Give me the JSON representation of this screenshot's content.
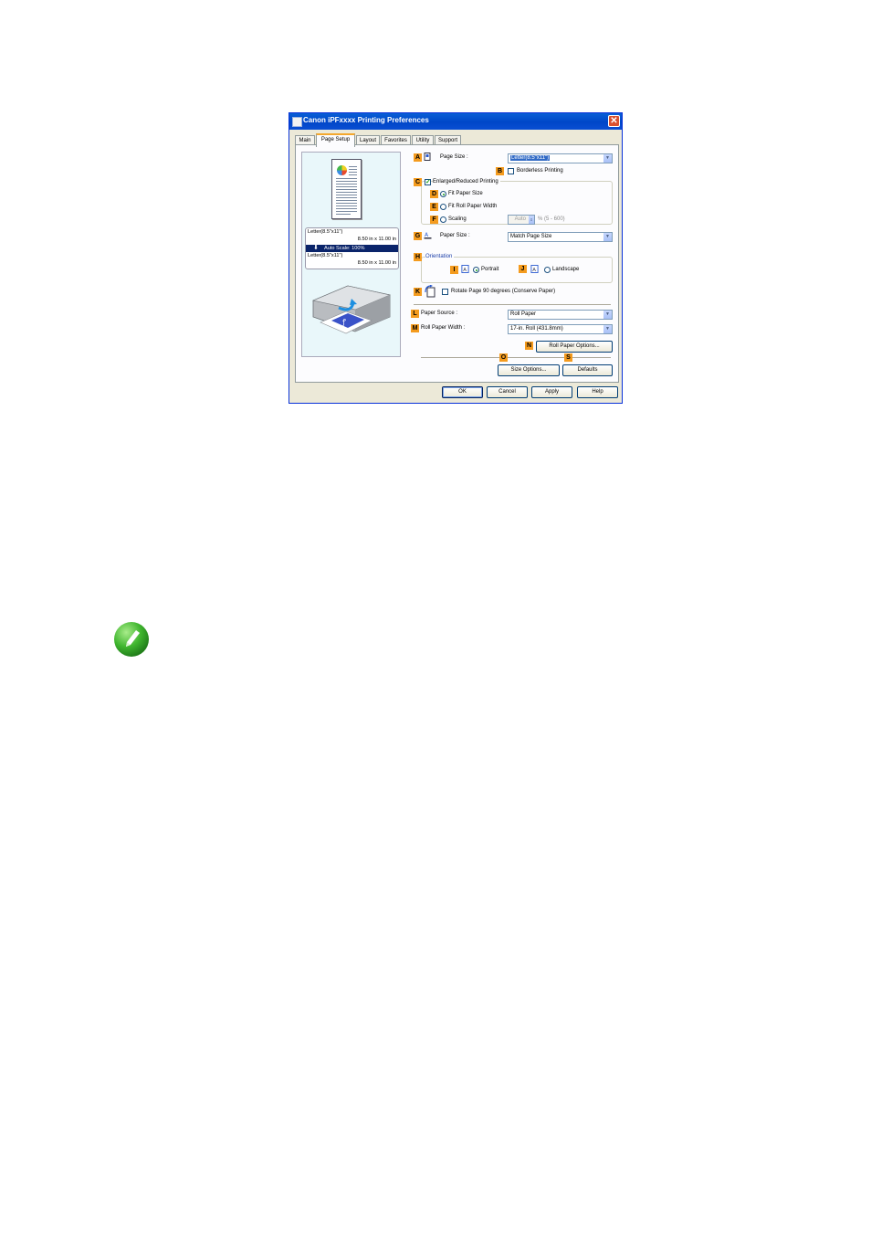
{
  "window": {
    "title": "Canon iPFxxxx Printing Preferences",
    "close_symbol": "✕",
    "title_icon": "printer-icon"
  },
  "tabs": [
    {
      "label": "Main",
      "active": false
    },
    {
      "label": "Page Setup",
      "active": true
    },
    {
      "label": "Layout",
      "active": false
    },
    {
      "label": "Favorites",
      "active": false
    },
    {
      "label": "Utility",
      "active": false
    },
    {
      "label": "Support",
      "active": false
    }
  ],
  "preview": {
    "original_size": "Letter(8.5\"x11\")",
    "original_dims": "8.50 in x 11.00 in",
    "scale_text": "Auto Scale: 100%",
    "output_size": "Letter(8.5\"x11\")",
    "output_dims": "8.50 in x 11.00 in"
  },
  "settings": {
    "page_size": {
      "badge": "A",
      "label": "Page Size :",
      "value": "Letter(8.5\"x11\")"
    },
    "borderless": {
      "badge": "B",
      "label": "Borderless Printing",
      "checked": false
    },
    "enlarged": {
      "badge": "C",
      "label": "Enlarged/Reduced Printing",
      "checked": true
    },
    "fit_paper": {
      "badge": "D",
      "label": "Fit Paper Size",
      "selected": true
    },
    "fit_roll": {
      "badge": "E",
      "label": "Fit Roll Paper Width",
      "selected": false
    },
    "scaling": {
      "badge": "F",
      "label": "Scaling",
      "value": "Auto",
      "range": "% (5 - 600)",
      "selected": false
    },
    "paper_size": {
      "badge": "G",
      "label": "Paper Size :",
      "value": "Match Page Size"
    },
    "orientation": {
      "badge": "H",
      "label": "Orientation"
    },
    "portrait": {
      "badge": "I",
      "label": "Portrait",
      "selected": true
    },
    "landscape": {
      "badge": "J",
      "label": "Landscape",
      "selected": false
    },
    "rotate": {
      "badge": "K",
      "label": "Rotate Page 90 degrees (Conserve Paper)",
      "checked": false
    },
    "paper_source": {
      "badge": "L",
      "label": "Paper Source :",
      "value": "Roll Paper"
    },
    "roll_width": {
      "badge": "M",
      "label": "Roll Paper Width :",
      "value": "17-in. Roll (431.8mm)"
    },
    "roll_options": {
      "badge": "N",
      "label": "Roll Paper Options..."
    },
    "size_options": {
      "badge": "O",
      "label": "Size Options..."
    },
    "defaults": {
      "badge": "S",
      "label": "Defaults"
    }
  },
  "buttons": {
    "ok": "OK",
    "cancel": "Cancel",
    "apply": "Apply",
    "help": "Help"
  },
  "note_icon": "pencil-note-icon",
  "colors": {
    "title_bar": "#0054e3",
    "badge": "#f49b1e",
    "preview_bg": "#e9f7fa",
    "note_green": "#3fb52e"
  }
}
